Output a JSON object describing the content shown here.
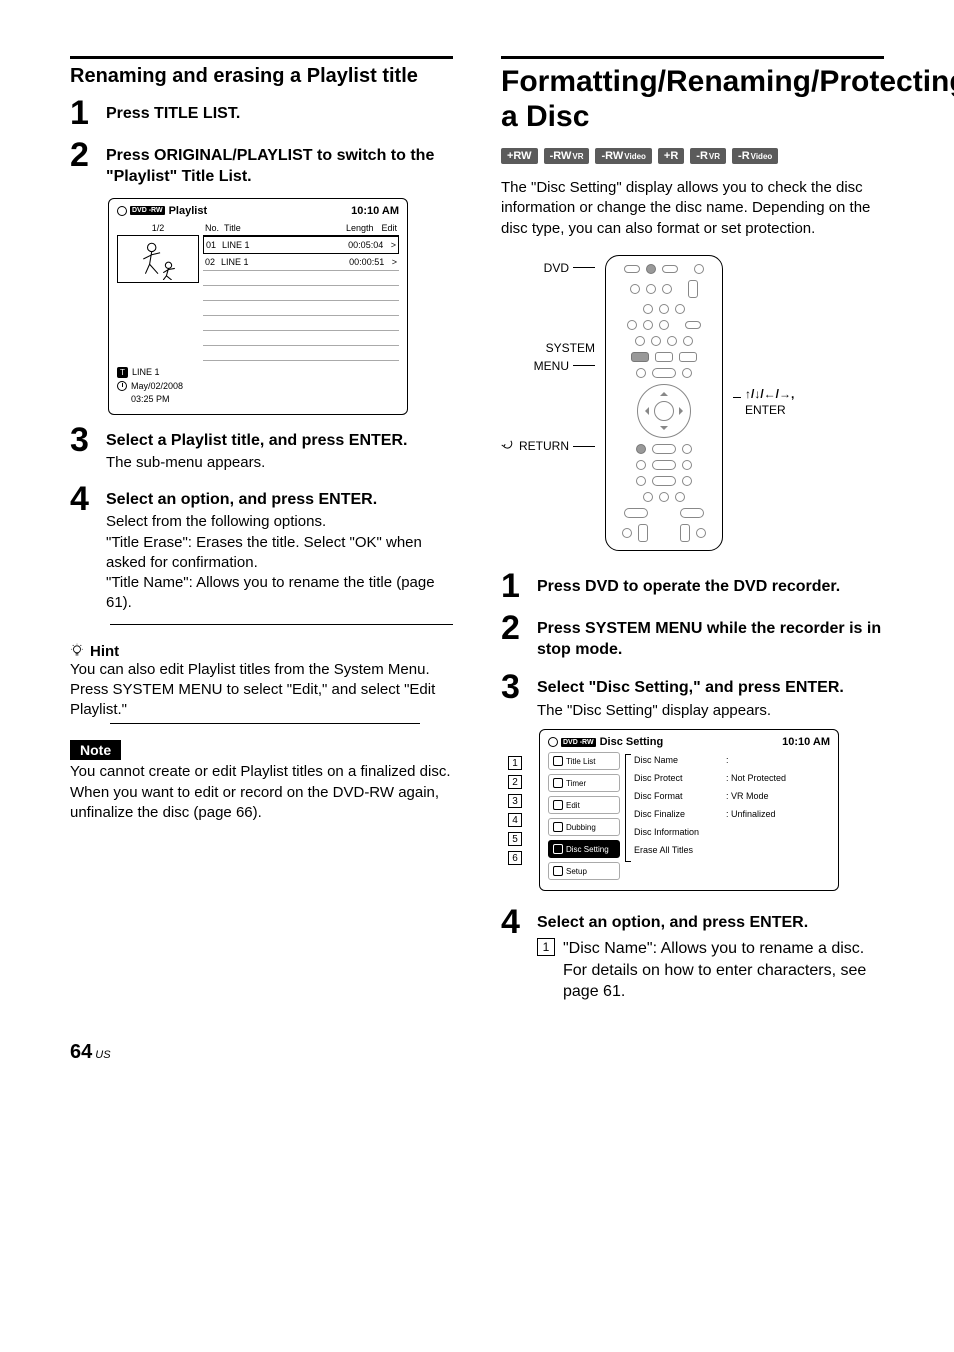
{
  "left": {
    "heading": "Renaming and erasing a Playlist title",
    "steps": {
      "s1": {
        "title": "Press TITLE LIST."
      },
      "s2": {
        "title": "Press ORIGINAL/PLAYLIST to switch to the \"Playlist\" Title List."
      },
      "s3": {
        "title": "Select a Playlist title, and press ENTER.",
        "desc": "The sub-menu appears."
      },
      "s4": {
        "title": "Select an option, and press ENTER.",
        "desc1": "Select from the following options.",
        "desc2": "\"Title Erase\": Erases the title. Select \"OK\" when asked for confirmation.",
        "desc3": "\"Title Name\": Allows you to rename the title (page 61)."
      }
    },
    "screen": {
      "dvd_label": "DVD\n-RW",
      "title": "Playlist",
      "clock": "10:10 AM",
      "count": "1/2",
      "cols": {
        "no": "No.",
        "title": "Title",
        "length": "Length",
        "edit": "Edit"
      },
      "rows": [
        {
          "no": "01",
          "title": "LINE 1",
          "length": "00:05:04",
          "edit": ">"
        },
        {
          "no": "02",
          "title": "LINE 1",
          "length": "00:00:51",
          "edit": ">"
        }
      ],
      "foot_title": "LINE 1",
      "foot_date": "May/02/2008",
      "foot_time": "03:25  PM"
    },
    "hint": {
      "label": "Hint",
      "text": "You can also edit Playlist titles from the System Menu. Press SYSTEM MENU to select \"Edit,\" and select \"Edit Playlist.\""
    },
    "note": {
      "label": "Note",
      "text": "You cannot create or edit Playlist titles on a finalized disc. When you want to edit or record on the DVD-RW again, unfinalize the disc (page 66)."
    }
  },
  "right": {
    "heading": "Formatting/Renaming/Protecting a Disc",
    "tags": [
      "+RW",
      "-RWVR",
      "-RWVideo",
      "+R",
      "-RVR",
      "-RVideo"
    ],
    "intro": "The \"Disc Setting\" display allows you to check the disc information or change the disc name. Depending on the disc type, you can also format or set protection.",
    "remote_labels": {
      "dvd": "DVD",
      "menu_l1": "SYSTEM",
      "menu_l2": "MENU",
      "return": "RETURN",
      "nav": "↑/↓/←/→,",
      "enter": "ENTER"
    },
    "steps": {
      "s1": {
        "title": "Press DVD to operate the DVD recorder."
      },
      "s2": {
        "title": "Press SYSTEM MENU while the recorder is in stop mode."
      },
      "s3": {
        "title": "Select \"Disc Setting,\" and press ENTER.",
        "desc": "The \"Disc Setting\" display appears."
      },
      "s4": {
        "title": "Select an option, and press ENTER.",
        "enum1_a": "\"Disc Name\": Allows you to rename a disc.",
        "enum1_b": "For details on how to enter characters, see page 61."
      }
    },
    "screen": {
      "dvd_label": "DVD\n-RW",
      "title": "Disc Setting",
      "clock": "10:10 AM",
      "menu": [
        "Title List",
        "Timer",
        "Edit",
        "Dubbing",
        "Disc Setting",
        "Setup"
      ],
      "rows": [
        {
          "k": "Disc Name",
          "v": ":"
        },
        {
          "k": "Disc Protect",
          "v": ":  Not Protected"
        },
        {
          "k": "Disc Format",
          "v": ":  VR Mode"
        },
        {
          "k": "Disc Finalize",
          "v": ":  Unfinalized"
        },
        {
          "k": "Disc Information",
          "v": ""
        },
        {
          "k": "Erase All Titles",
          "v": ""
        }
      ],
      "callouts": [
        "1",
        "2",
        "3",
        "4",
        "5",
        "6"
      ]
    }
  },
  "footer": {
    "page": "64",
    "lang": "US"
  }
}
